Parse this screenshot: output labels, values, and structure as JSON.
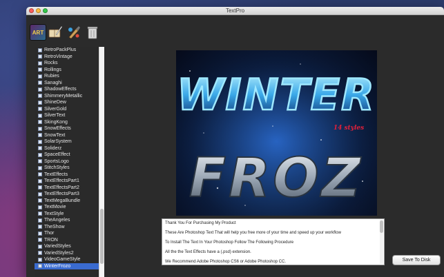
{
  "window": {
    "title": "TextPro"
  },
  "toolbar": {
    "buttons": [
      {
        "name": "art-icon",
        "glyph": "ART"
      },
      {
        "name": "book-quill-icon"
      },
      {
        "name": "paint-brush-icon"
      },
      {
        "name": "trash-icon"
      }
    ]
  },
  "styles_list": {
    "items": [
      "RetroPackPlus",
      "RetroVintage",
      "Rocks",
      "Rollings",
      "Rubies",
      "Sanaghi",
      "ShadowEffects",
      "ShimmeryMetallic",
      "ShineDew",
      "SilverGold",
      "SilverText",
      "SkingKong",
      "SnowEffects",
      "SnowText",
      "SolarSystem",
      "Soliderz",
      "SpaceEffect",
      "SportsLogo",
      "StitchStyles",
      "TextEffects",
      "TextEffectsPart1",
      "TextEffectsPart2",
      "TextEffectsPart3",
      "TextMegaBundle",
      "TextMovie",
      "TextStyle",
      "TheAngeles",
      "TheShow",
      "Thor",
      "TRON",
      "VariedStyles",
      "VariedStyles2",
      "VideoGameStyle",
      "WinterFrozo"
    ],
    "selected": "WinterFrozo"
  },
  "preview": {
    "title_top": "WINTER",
    "tagline": "14 styles",
    "title_bottom": "FROZ"
  },
  "description": {
    "lines": [
      "Thank You For Purchasing My Product",
      "These Are Photoshop Text That will help you free more of your time and speed up your workflow",
      "To Install The Text In Your Photoshop Follow The Following Procedure",
      "All the the Text Effects have a (.psd) extension.",
      "We Recommend Adobe Photoshop CS6 or Adobe Photoshop CC."
    ]
  },
  "actions": {
    "save_label": "Save To Disk"
  },
  "colors": {
    "selection": "#3a6bd0",
    "window_bg": "#2b2b2b",
    "preview_glow": "#4fd0ff"
  }
}
